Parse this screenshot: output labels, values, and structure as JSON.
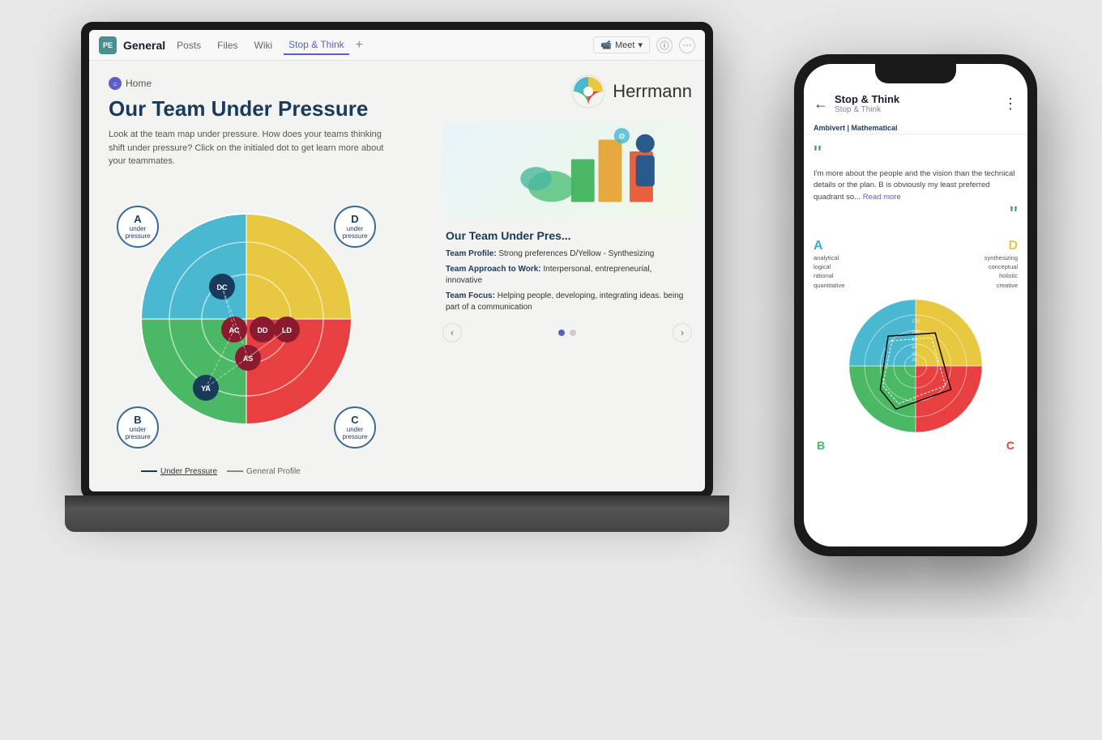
{
  "scene": {
    "laptop": {
      "browser": {
        "channel_icon": "PE",
        "channel_name": "General",
        "tabs": [
          "Posts",
          "Files",
          "Wiki",
          "Stop & Think"
        ],
        "active_tab": "Stop & Think",
        "meet_label": "Meet",
        "info_icon": "ⓘ",
        "more_icon": "..."
      },
      "content": {
        "home_label": "Home",
        "page_title": "Our Team Under Pressure",
        "page_desc": "Look at the team map under pressure.  How does your teams thinking shift under pressure?  Click on the initialed dot to get learn more about your teammates.",
        "quadrant_labels": {
          "a": {
            "letter": "A",
            "sub": "under",
            "sub2": "pressure"
          },
          "b": {
            "letter": "B",
            "sub": "under",
            "sub2": "pressure"
          },
          "c": {
            "letter": "C",
            "sub": "under",
            "sub2": "pressure"
          },
          "d": {
            "letter": "D",
            "sub": "under",
            "sub2": "pressure"
          }
        },
        "people_dots": [
          "DC",
          "AC",
          "DD",
          "LD",
          "AS",
          "YA"
        ],
        "legend_under": "Under Pressure",
        "legend_general": "General Profile"
      },
      "right_panel": {
        "herrmann_name": "Herrmann",
        "team_profile_title": "Our Team Under Pres...",
        "team_profile_label": "Team Profile:",
        "team_profile_value": "Strong preferences D/Yellow - Synthesizing",
        "team_approach_label": "Team Approach to Work:",
        "team_approach_value": "Interpersonal, entrepreneurial, innovative",
        "team_focus_label": "Team Focus:",
        "team_focus_value": "Helping people, developing, integrating ideas. being part of a communication",
        "carousel_prev": "‹",
        "carousel_next": "›"
      }
    },
    "phone": {
      "back_icon": "←",
      "title": "Stop & Think",
      "subtitle": "Stop & Think",
      "menu_icon": "⋮",
      "badge": "Ambivert | Mathematical",
      "quote_text": "I'm more about the people and the vision than the technical details or the plan. B is obviously my least preferred quadrant so...",
      "read_more": "Read more",
      "quadrant": {
        "a_letter": "A",
        "d_letter": "D",
        "b_letter": "B",
        "c_letter": "C",
        "a_traits": [
          "analytical",
          "logical",
          "rational",
          "quantitative"
        ],
        "d_traits": [
          "synthesizing",
          "conceptual",
          "holistic",
          "creative"
        ],
        "b_traits": [
          ""
        ],
        "c_traits": [
          ""
        ]
      }
    }
  }
}
